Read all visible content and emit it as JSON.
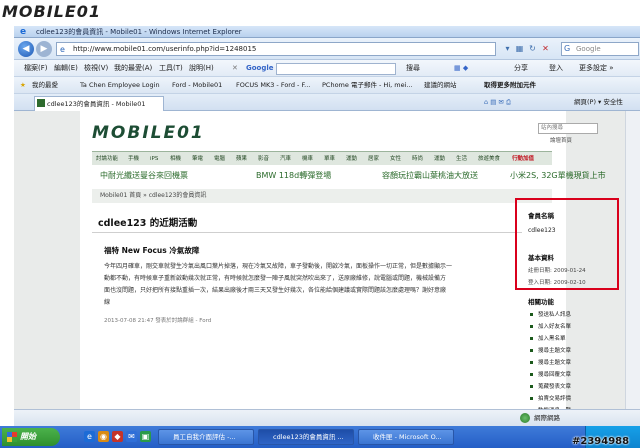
{
  "watermark": {
    "logo_text": "MOBILE01",
    "id_text": "#2394988"
  },
  "window": {
    "title": "cdlee123的會員資訊 - Mobile01 - Windows Internet Explorer"
  },
  "address_bar": {
    "url": "http://www.mobile01.com/userinfo.php?id=1248015",
    "search_placeholder": "Google"
  },
  "menu": {
    "items": [
      "檔案(F)",
      "編輯(E)",
      "檢視(V)",
      "我的最愛(A)",
      "工具(T)",
      "說明(H)"
    ],
    "google_label": "Google",
    "right_items": [
      "搜尋",
      "分享",
      "登入",
      "更多設定 »"
    ]
  },
  "favorites": {
    "label": "我的最愛",
    "items": [
      "Ta Chen Employee Login",
      "Ford - Mobile01",
      "FOCUS MK3 - Ford - F...",
      "PChome 電子郵件 - Hi, mei...",
      "建議的網站",
      "取得更多附加元件"
    ]
  },
  "tabs": [
    {
      "label": "cdlee123的會員資訊 - Mobile01"
    }
  ],
  "page": {
    "logo": "MOBILE01",
    "search_button": "站內搜尋",
    "login_links": "論壇首頁",
    "categories": [
      "討論功能",
      "手機",
      "iPS",
      "相機",
      "筆電",
      "電腦",
      "蘋果",
      "影音",
      "汽車",
      "機車",
      "單車",
      "運動",
      "居家",
      "女性",
      "時尚",
      "運動",
      "生活",
      "旅遊美食",
      "行動加值"
    ],
    "promos": [
      "中耐光纖送曼谷來回機票",
      "BMW 118d轉彈登場",
      "容顏玩拉霸山葉桃油大放送",
      "小米2S, 32G單機現貨上市"
    ],
    "breadcrumb": "Mobile01 首頁 » cdlee123的會員資訊",
    "heading": "cdlee123 的近期活動",
    "post": {
      "title": "福特 New Focus 冷氣故障",
      "lines": [
        "今年四月確車，剛交車就發生冷氣出風口葉片掉落，現在冷氣又故障，車子發動後，開啟冷氣，面板操作一切正常，但是數據顯示一",
        "動都不動，有時候車子重新啟動幾次就正常，有時候就怎麼發一陣子風就突然吹出來了，送原廠維修，說電腦或問題，機械設備方",
        "面也沒問題，只好把所有接點重插一次，結果出廠後才兩三天又發生好幾次，各位能給個建議或實際問題該怎麼處理嗎？謝好意廠",
        "線"
      ],
      "meta": "2013-07-08 21:47 發表於討論群組 - Ford"
    },
    "sidebar": {
      "member_label": "會員名稱",
      "member_value": "cdlee123",
      "basic_label": "基本資料",
      "register": "註冊日期: 2009-01-24",
      "last_login": "登入日期: 2009-02-10",
      "functions_label": "相關功能",
      "links": [
        "發送私人訊息",
        "加入好友名單",
        "加入黑名單",
        "搜尋主題文章",
        "搜尋主題文章",
        "搜尋回覆文章",
        "蒐藏發表文章",
        "拍賣交易評價",
        "動態消息一覽",
        "影片分享一覽"
      ]
    }
  },
  "status_bar": {
    "text": "網際網路"
  },
  "taskbar": {
    "start_label": "開始",
    "tasks": [
      "員工自我介面評估 -...",
      "cdlee123的會員資訊 ...",
      "收件匣 - Microsoft O..."
    ],
    "active_index": 1
  },
  "colors": {
    "accent_red": "#d9001c",
    "brand_green": "#1d4d34",
    "taskbar_blue": "#245ec6"
  }
}
